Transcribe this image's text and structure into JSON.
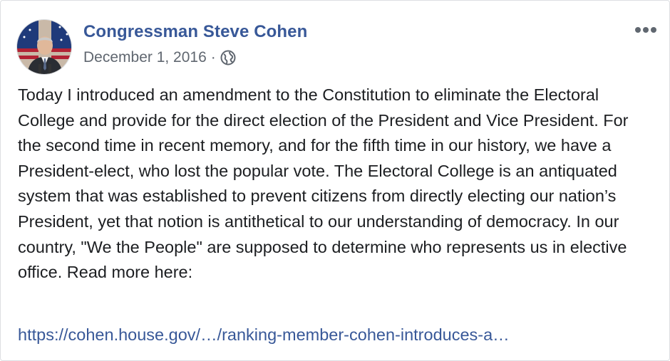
{
  "post": {
    "author_name": "Congressman Steve Cohen",
    "date": "December 1, 2016",
    "separator": "·",
    "privacy_icon": "globe-icon",
    "more_icon": "more-options-icon",
    "body": "Today I introduced an amendment to the Constitution to eliminate the Electoral College and provide for the direct election of the President and Vice President. For the second time in recent memory, and for the fifth time in our history, we have a President-elect, who lost the popular vote. The Electoral College is an antiquated system that was established to prevent citizens from directly electing our nation’s President, yet that notion is antithetical to our understanding of democracy. In our country, \"We the People\" are supposed to determine who represents us in elective office. Read more here:",
    "link_text": "https://cohen.house.gov/…/ranking-member-cohen-introduces-a…"
  },
  "colors": {
    "author": "#385898",
    "link": "#385898",
    "text": "#1c1e21",
    "meta": "#606770",
    "border": "#dddfe2"
  }
}
